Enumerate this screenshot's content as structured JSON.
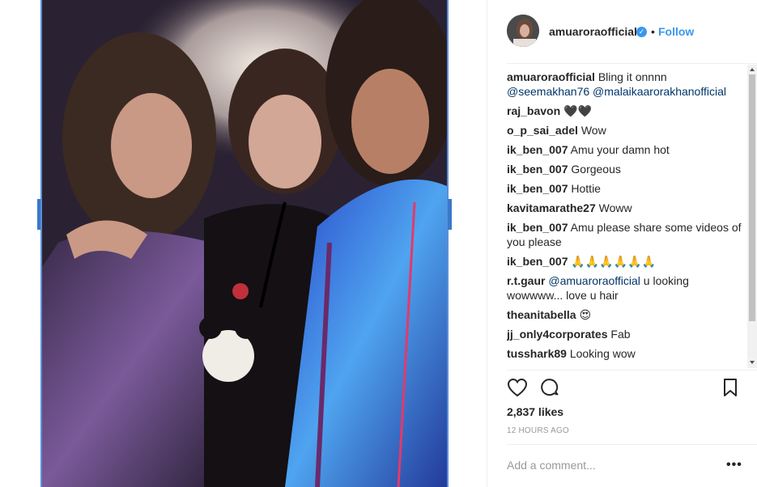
{
  "post": {
    "username": "amuaroraofficial",
    "verified_icon": "verified-badge-icon",
    "separator": "•",
    "follow_label": "Follow",
    "likes": "2,837 likes",
    "time": "12 HOURS AGO",
    "add_comment_placeholder": "Add a comment...",
    "more_label": "•••"
  },
  "comments": [
    {
      "user": "amuaroraofficial",
      "text": "Bling it onnnn ",
      "mentions": "@seemakhan76 @malaikaarorakhanofficial"
    },
    {
      "user": "raj_bavon",
      "text": "🖤🖤"
    },
    {
      "user": "o_p_sai_adel",
      "text": "Wow"
    },
    {
      "user": "ik_ben_007",
      "text": "Amu your damn hot"
    },
    {
      "user": "ik_ben_007",
      "text": "Gorgeous"
    },
    {
      "user": "ik_ben_007",
      "text": "Hottie"
    },
    {
      "user": "kavitamarathe27",
      "text": "Woww"
    },
    {
      "user": "ik_ben_007",
      "text": "Amu please share some videos of you please"
    },
    {
      "user": "ik_ben_007",
      "text": "🙏🙏🙏🙏🙏🙏"
    },
    {
      "user": "r.t.gaur",
      "mention": "@amuaroraofficial",
      "text": " u looking wowwww... love u hair"
    },
    {
      "user": "theanitabella",
      "text": "😍"
    },
    {
      "user": "jj_only4corporates",
      "text": "Fab"
    },
    {
      "user": "tusshark89",
      "text": "Looking wow"
    }
  ],
  "icons": {
    "like": "heart-icon",
    "comment": "comment-icon",
    "save": "bookmark-icon"
  },
  "colors": {
    "link_blue": "#3897f0",
    "mention_blue": "#003569",
    "frame_border": "#5b8fd6"
  }
}
